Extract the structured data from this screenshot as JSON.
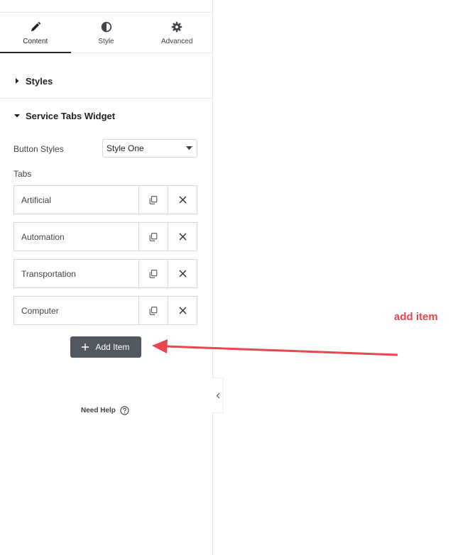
{
  "tabs": [
    {
      "label": "Content",
      "icon": "pencil-icon",
      "active": true
    },
    {
      "label": "Style",
      "icon": "half-circle-icon",
      "active": false
    },
    {
      "label": "Advanced",
      "icon": "gear-icon",
      "active": false
    }
  ],
  "sections": {
    "styles": {
      "title": "Styles",
      "expanded": false
    },
    "service_tabs": {
      "title": "Service Tabs Widget",
      "expanded": true
    }
  },
  "controls": {
    "button_styles_label": "Button Styles",
    "button_styles_value": "Style One",
    "tabs_label": "Tabs"
  },
  "repeater_items": [
    {
      "title": "Artificial"
    },
    {
      "title": "Automation"
    },
    {
      "title": "Transportation"
    },
    {
      "title": "Computer"
    }
  ],
  "add_item_label": "Add Item",
  "need_help_label": "Need Help",
  "annotation_text": "add item",
  "colors": {
    "annotation": "#e5484d",
    "add_button_bg": "#525860",
    "border": "#d5d8dc"
  }
}
